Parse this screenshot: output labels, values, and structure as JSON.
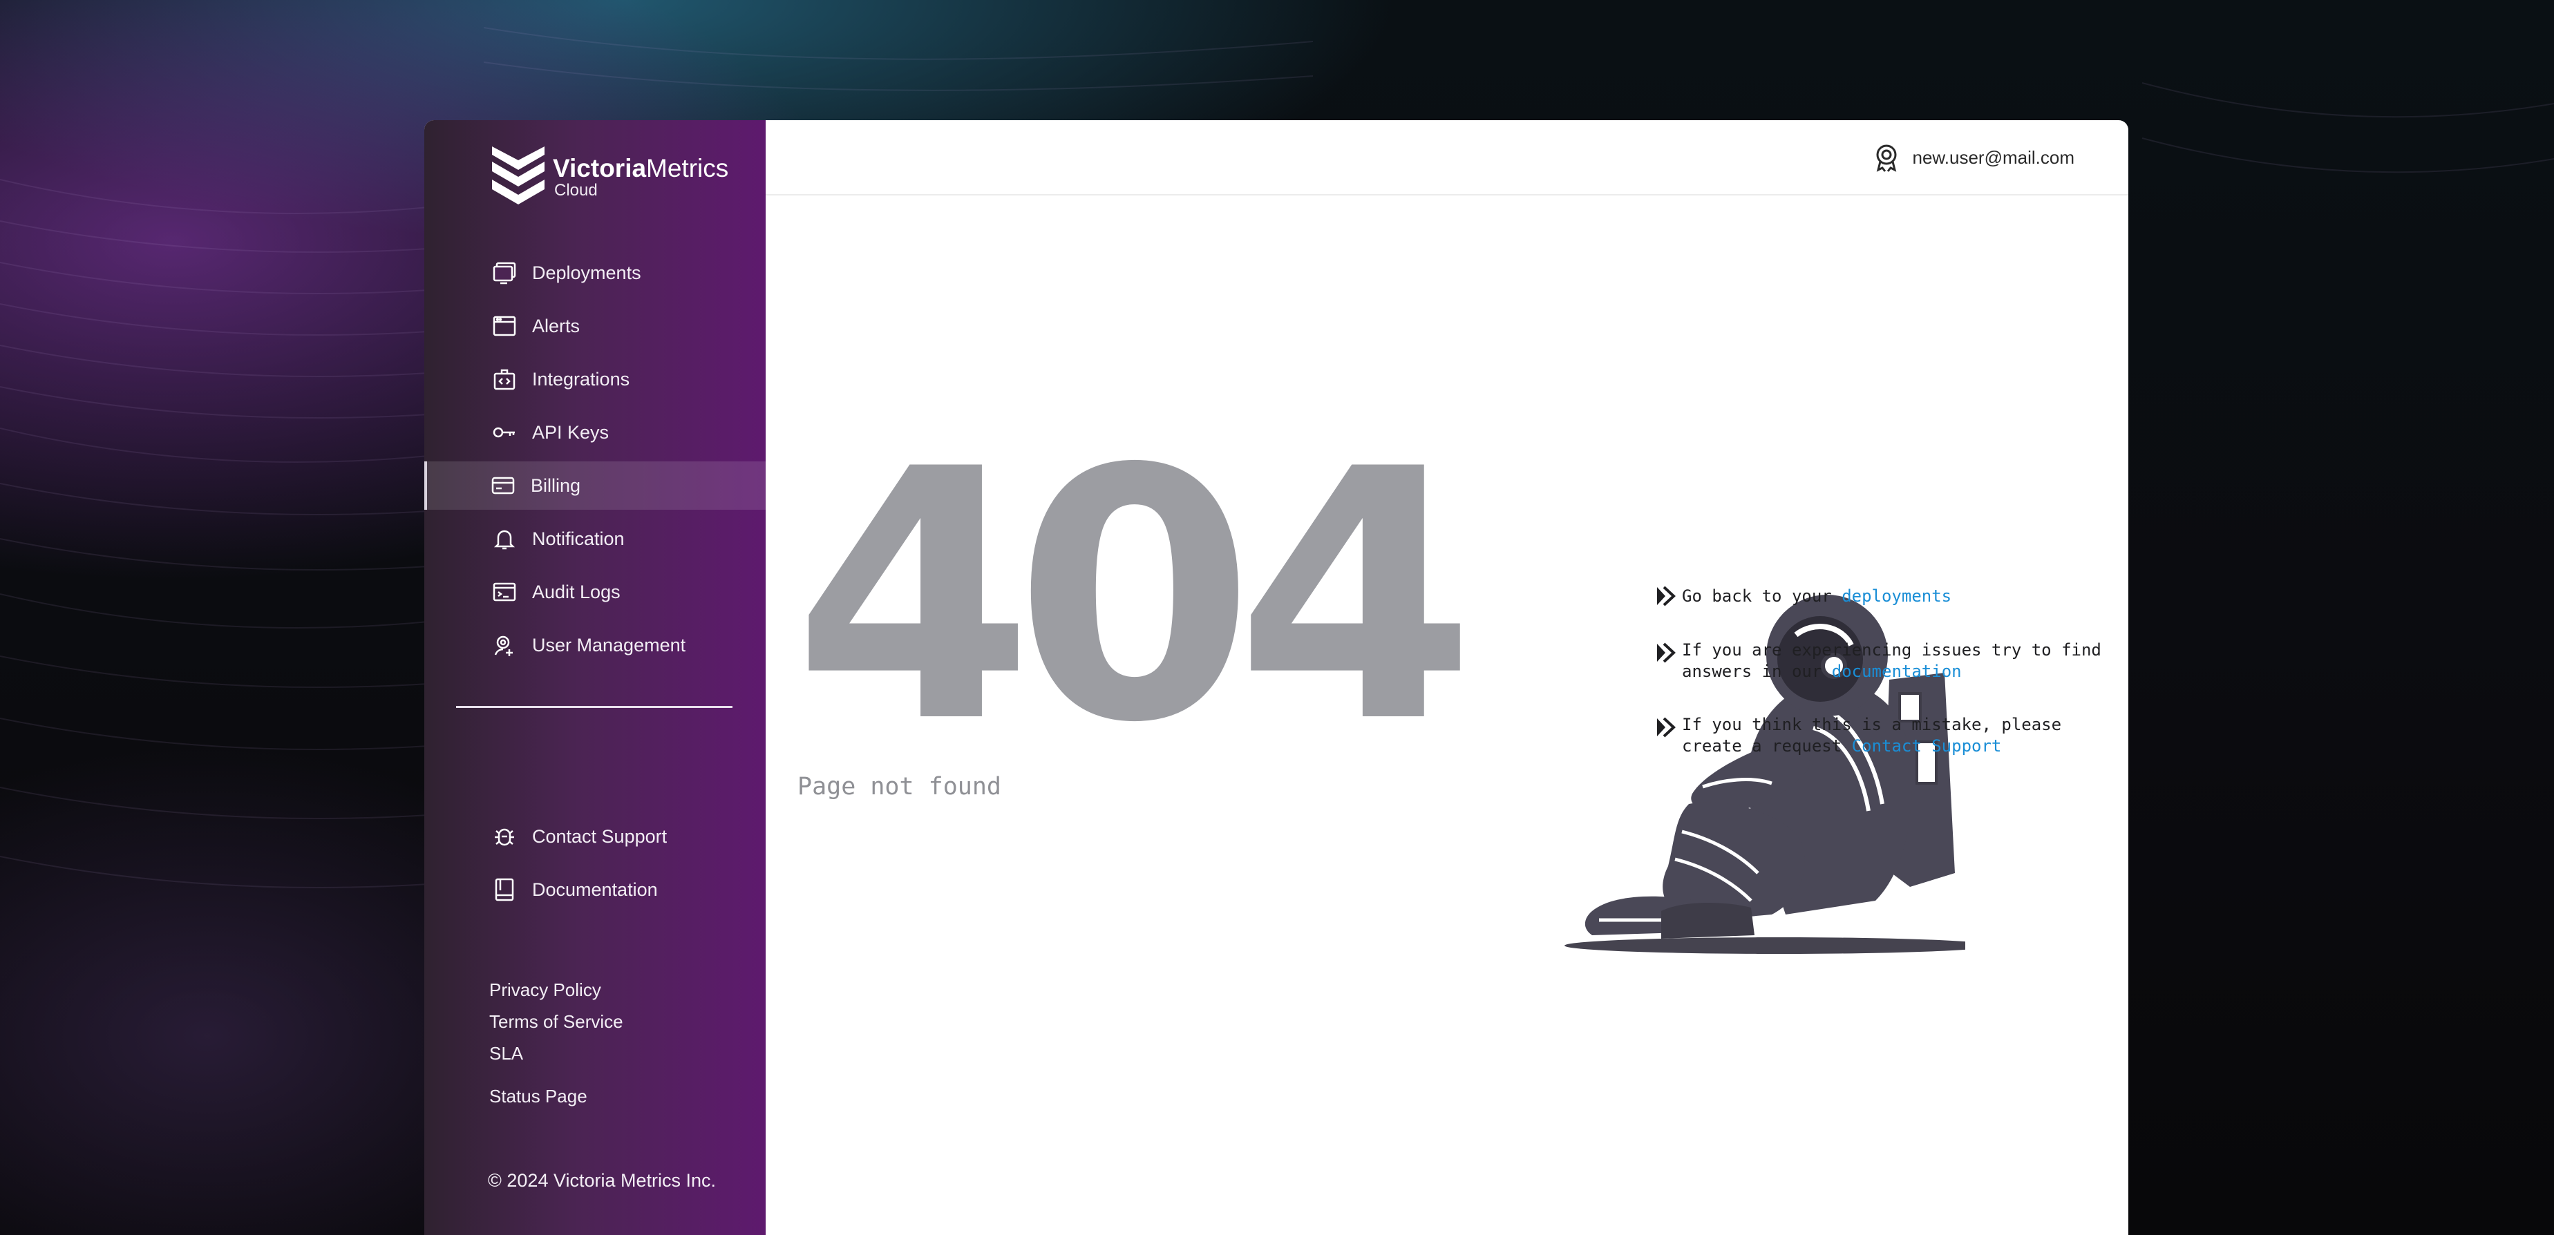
{
  "brand": {
    "name_bold": "Victoria",
    "name_regular": "Metrics",
    "sub": "Cloud"
  },
  "user": {
    "email": "new.user@mail.com"
  },
  "nav": [
    {
      "label": "Deployments",
      "icon": "monitor-icon"
    },
    {
      "label": "Alerts",
      "icon": "alert-window-icon"
    },
    {
      "label": "Integrations",
      "icon": "integrations-icon"
    },
    {
      "label": "API Keys",
      "icon": "key-icon"
    },
    {
      "label": "Billing",
      "icon": "credit-card-icon",
      "active": true
    },
    {
      "label": "Notification",
      "icon": "bell-icon"
    },
    {
      "label": "Audit Logs",
      "icon": "terminal-icon"
    },
    {
      "label": "User Management",
      "icon": "user-add-icon"
    }
  ],
  "nav_secondary": [
    {
      "label": "Contact Support",
      "icon": "bug-icon"
    },
    {
      "label": "Documentation",
      "icon": "book-icon"
    }
  ],
  "footer": {
    "privacy": "Privacy Policy",
    "terms": "Terms of Service",
    "sla": "SLA",
    "status": "Status Page",
    "copyright": "© 2024 Victoria Metrics Inc."
  },
  "error": {
    "code": "404",
    "message": "Page not found"
  },
  "help": {
    "row1_text": "Go back to your ",
    "row1_link": "deployments",
    "row2_text": "If you are experiencing issues try to find\nanswers in our ",
    "row2_link": "documentation",
    "row3_text": "If you think this is a mistake, please\ncreate a request ",
    "row3_link": "Contact Support"
  },
  "colors": {
    "sidebar_start": "#2f2230",
    "sidebar_end": "#5e1a6e",
    "link": "#1a8ed6",
    "error_gray": "#9c9da2"
  }
}
